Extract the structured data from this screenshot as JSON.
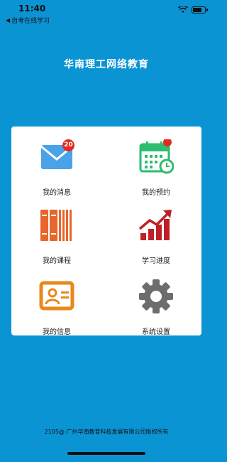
{
  "status_bar": {
    "time": "11:40",
    "back_label": "自考在线学习"
  },
  "header": {
    "title": "华南理工网络教育"
  },
  "menu": {
    "messages": {
      "label": "我的消息",
      "badge": "20",
      "icon": "mail-icon"
    },
    "appointments": {
      "label": "我的预约",
      "icon": "calendar-icon"
    },
    "courses": {
      "label": "我的课程",
      "icon": "books-icon"
    },
    "progress": {
      "label": "学习进度",
      "icon": "growth-chart-icon"
    },
    "info": {
      "label": "我的信息",
      "icon": "id-card-icon"
    },
    "settings": {
      "label": "系统设置",
      "icon": "gear-icon"
    }
  },
  "footer": {
    "copyright": "2105@ 广州华南教育科技发展有限公司版权所有"
  },
  "colors": {
    "background": "#0b94d4",
    "mail": "#4aa3e8",
    "calendar": "#2dbd6e",
    "books": "#e8662a",
    "chart": "#c01f27",
    "idcard": "#e8891a",
    "gear": "#6d6d6d",
    "badge": "#e22a1e"
  }
}
